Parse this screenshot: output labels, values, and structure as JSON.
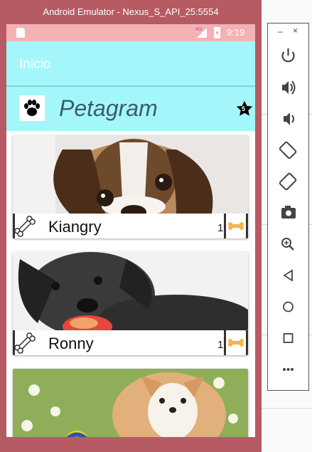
{
  "window": {
    "title": "Android Emulator - Nexus_S_API_25:5554"
  },
  "status_bar": {
    "time": "9:19",
    "network_badge": "4G"
  },
  "toolbar": {
    "title": "Inicio"
  },
  "action_bar": {
    "app_name": "Petagram",
    "favorites_count": "5"
  },
  "pets": [
    {
      "name": "Kiangry",
      "likes": "1"
    },
    {
      "name": "Ronny",
      "likes": "1"
    },
    {
      "name": "",
      "likes": ""
    }
  ],
  "side_toolbar": {
    "minimize": "–",
    "close": "×",
    "buttons": [
      "power-icon",
      "volume-up-icon",
      "volume-down-icon",
      "rotate-left-icon",
      "rotate-right-icon",
      "camera-icon",
      "zoom-icon",
      "back-icon",
      "home-icon",
      "overview-icon",
      "more-icon"
    ]
  },
  "colors": {
    "window_frame": "#b65a63",
    "status_bar": "#f4b1b6",
    "app_bar": "#a3f7fb",
    "title_text": "#3b5c68"
  }
}
